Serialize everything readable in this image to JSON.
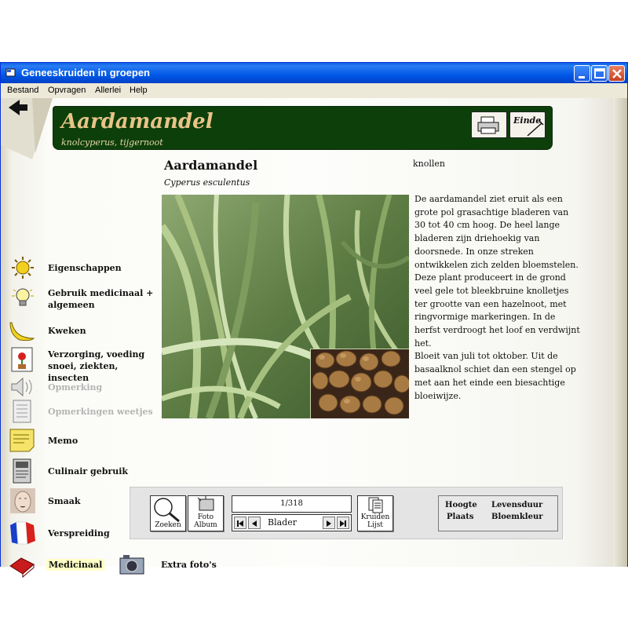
{
  "window": {
    "title": "Geneeskruiden in groepen"
  },
  "menu": [
    "Bestand",
    "Opvragen",
    "Allerlei",
    "Help"
  ],
  "header": {
    "title": "Aardamandel",
    "subtitle": "knolcyperus, tijgernoot",
    "print_icon": "printer-icon",
    "exit_label": "Einde"
  },
  "plant": {
    "name": "Aardamandel",
    "latin": "Cyperus esculentus",
    "part": "knollen",
    "description": [
      "De aardamandel ziet eruit als een grote pol grasachtige bladeren van 30 tot 40 cm hoog. De heel lange bladeren zijn driehoekig van doorsnede. In onze streken ontwikkelen zich zelden bloemstelen. Deze plant produceert in de grond veel gele tot bleekbruine knolletjes ter grootte van een hazelnoot, met ringvormige markeringen. In de herfst verdroogt het loof en verdwijnt het.",
      "Bloeit van juli tot oktober. Uit de basaalknol schiet dan een stengel op met aan het einde een biesachtige bloeiwijze."
    ]
  },
  "sidebar": [
    {
      "label": "Eigenschappen",
      "icon": "sun-icon"
    },
    {
      "label": "Gebruik medicinaal +\nalgemeen",
      "icon": "lightbulb-icon"
    },
    {
      "label": "Kweken",
      "icon": "banana-icon"
    },
    {
      "label": "Verzorging, voeding\nsnoei, ziekten, insecten",
      "icon": "flowerpot-icon"
    },
    {
      "label": "Opmerking",
      "icon": "speaker-icon",
      "disabled": true
    },
    {
      "label": "Opmerkingen weetjes",
      "icon": "notes-icon",
      "disabled": true
    },
    {
      "label": "Memo",
      "icon": "memo-icon"
    },
    {
      "label": "Culinair gebruik",
      "icon": "recipe-icon"
    },
    {
      "label": "Smaak",
      "icon": "face-icon"
    },
    {
      "label": "Verspreiding",
      "icon": "flag-map-icon"
    },
    {
      "label": "Medicinaal",
      "icon": "book-icon",
      "highlighted": true
    }
  ],
  "extra_photos": {
    "label": "Extra foto's",
    "icon": "camera-icon"
  },
  "toolbar": {
    "search_label": "Zoeken",
    "album_label": [
      "Foto",
      "Album"
    ],
    "counter": "1/318",
    "browse_label": "Blader",
    "list_label": [
      "Kruiden",
      "Lijst"
    ],
    "info": [
      "Hoogte",
      "Levensduur",
      "Plaats",
      "Bloemkleur"
    ]
  },
  "colors": {
    "header_bg": "#0d3f0b",
    "header_title": "#e8c487",
    "titlebar": "#0058e6",
    "highlight": "#ffffc6"
  }
}
